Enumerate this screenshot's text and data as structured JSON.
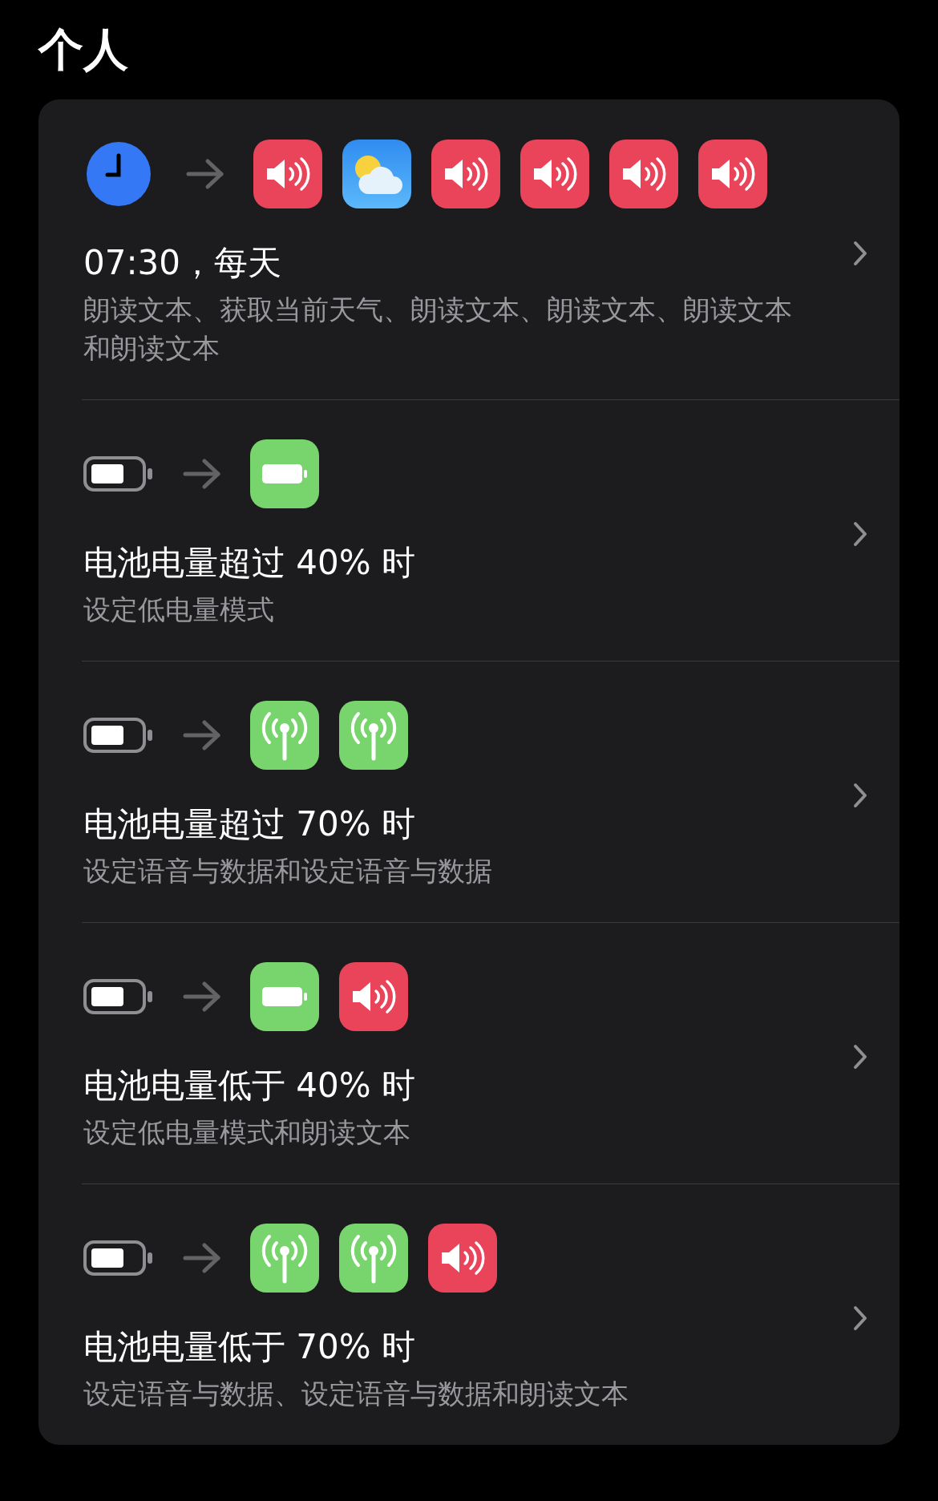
{
  "header": {
    "title": "个人"
  },
  "automations": [
    {
      "trigger": {
        "kind": "clock"
      },
      "actions": [
        {
          "kind": "speak"
        },
        {
          "kind": "weather"
        },
        {
          "kind": "speak"
        },
        {
          "kind": "speak"
        },
        {
          "kind": "speak"
        },
        {
          "kind": "speak"
        }
      ],
      "title": "07:30，每天",
      "subtitle": "朗读文本、获取当前天气、朗读文本、朗读文本、朗读文本和朗读文本"
    },
    {
      "trigger": {
        "kind": "battery"
      },
      "actions": [
        {
          "kind": "battery"
        }
      ],
      "title": "电池电量超过 40% 时",
      "subtitle": "设定低电量模式"
    },
    {
      "trigger": {
        "kind": "battery"
      },
      "actions": [
        {
          "kind": "cellular"
        },
        {
          "kind": "cellular"
        }
      ],
      "title": "电池电量超过 70% 时",
      "subtitle": "设定语音与数据和设定语音与数据"
    },
    {
      "trigger": {
        "kind": "battery"
      },
      "actions": [
        {
          "kind": "battery"
        },
        {
          "kind": "speak"
        }
      ],
      "title": "电池电量低于 40% 时",
      "subtitle": "设定低电量模式和朗读文本"
    },
    {
      "trigger": {
        "kind": "battery"
      },
      "actions": [
        {
          "kind": "cellular"
        },
        {
          "kind": "cellular"
        },
        {
          "kind": "speak"
        }
      ],
      "title": "电池电量低于 70% 时",
      "subtitle": "设定语音与数据、设定语音与数据和朗读文本"
    }
  ]
}
